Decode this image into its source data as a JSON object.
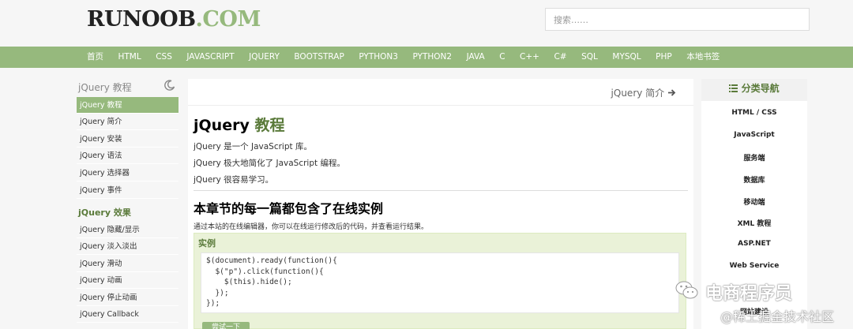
{
  "header": {
    "logo_part1": "RUNOOB",
    "logo_part2": ".COM",
    "search_placeholder": "搜索……"
  },
  "nav": [
    "首页",
    "HTML",
    "CSS",
    "JAVASCRIPT",
    "JQUERY",
    "BOOTSTRAP",
    "PYTHON3",
    "PYTHON2",
    "JAVA",
    "C",
    "C++",
    "C#",
    "SQL",
    "MYSQL",
    "PHP",
    "本地书签"
  ],
  "left": {
    "title": "jQuery 教程",
    "items1": [
      "jQuery 教程",
      "jQuery 简介",
      "jQuery 安装",
      "jQuery 语法",
      "jQuery 选择器",
      "jQuery 事件"
    ],
    "section2": "jQuery 效果",
    "items2": [
      "jQuery 隐藏/显示",
      "jQuery 淡入淡出",
      "jQuery 滑动",
      "jQuery 动画",
      "jQuery 停止动画",
      "jQuery Callback"
    ]
  },
  "main": {
    "next_link": "jQuery 简介",
    "title_a": "jQuery",
    "title_b": "教程",
    "p1": "jQuery 是一个 JavaScript 库。",
    "p2": "jQuery 极大地简化了 JavaScript 编程。",
    "p3": "jQuery 很容易学习。",
    "h2": "本章节的每一篇都包含了在线实例",
    "desc": "通过本站的在线编辑器，你可以在线运行修改后的代码，并查看运行结果。",
    "example_title": "实例",
    "code_lines": [
      "$(document).ready(function(){",
      "  $(\"p\").click(function(){",
      "    $(this).hide();",
      "  });",
      "});"
    ],
    "try_button": "尝试一下"
  },
  "right": {
    "title": "分类导航",
    "items": [
      "HTML / CSS",
      "JavaScript",
      "服务端",
      "数据库",
      "移动端",
      "XML 教程",
      "ASP.NET",
      "Web Service",
      "网站建设"
    ]
  },
  "watermark": {
    "line1": "电商程序员",
    "line2": "@稀土掘金技术社区"
  },
  "colors": {
    "accent": "#96b97d",
    "accent_dark": "#5a7a3a"
  }
}
